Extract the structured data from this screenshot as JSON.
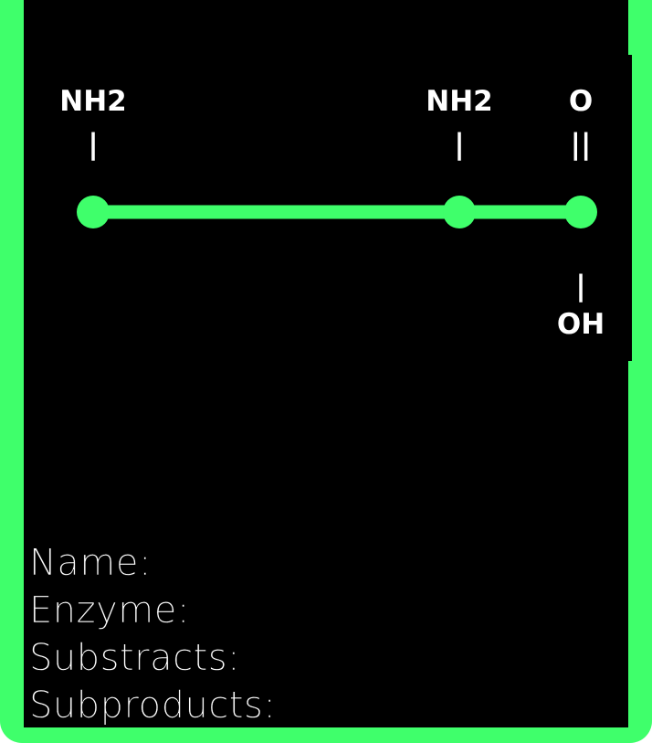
{
  "molecule": {
    "labels": {
      "top_left": "NH2",
      "top_middle": "NH2",
      "top_right": "O",
      "bottom_right": "OH"
    },
    "bond_marks": {
      "single": "|",
      "double": "||"
    }
  },
  "fields": {
    "name": "Name:",
    "enzyme": "Enzyme:",
    "substracts": "Substracts:",
    "subproducts": "Subproducts:"
  },
  "colors": {
    "accent": "#3fff6b",
    "background": "#000000",
    "text": "#ffffff"
  }
}
